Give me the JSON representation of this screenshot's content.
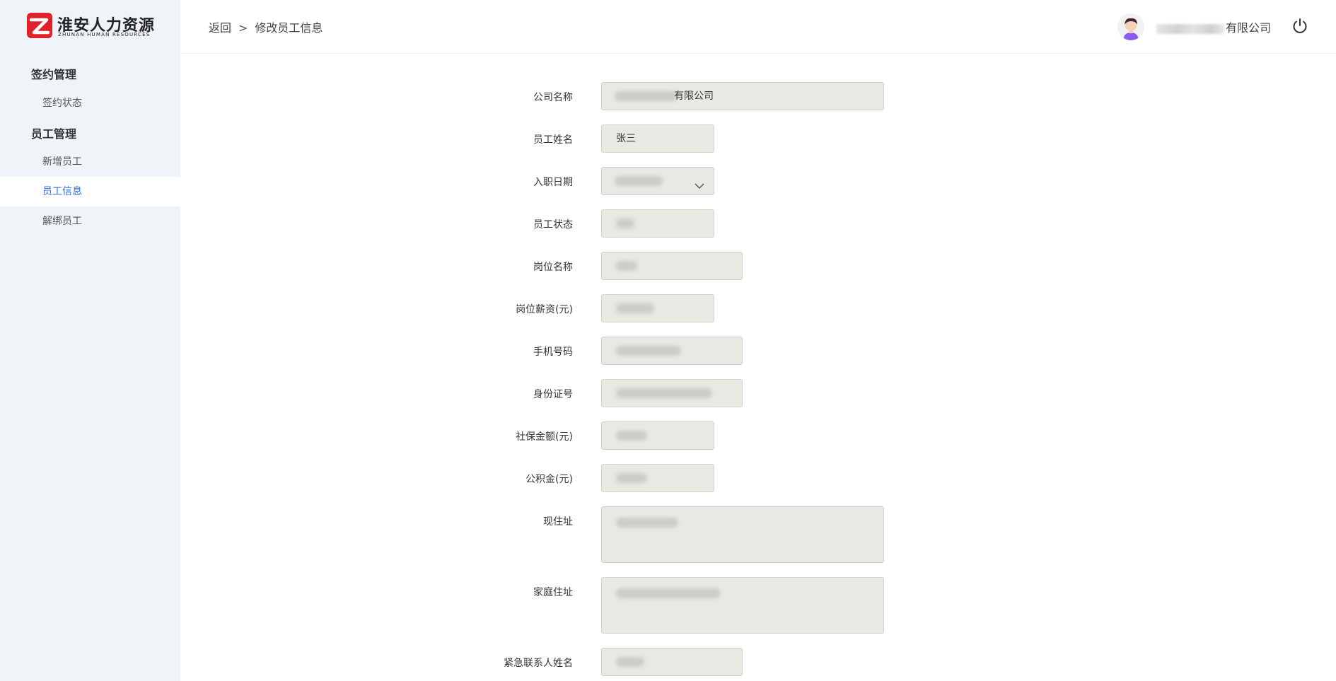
{
  "brand": {
    "name_cn": "淮安人力资源",
    "name_en": "ZHUNAN HUMAN RESOURCES",
    "color": "#e0222a"
  },
  "sidebar": {
    "groups": [
      {
        "title": "签约管理",
        "items": [
          {
            "label": "签约状态"
          }
        ]
      },
      {
        "title": "员工管理",
        "items": [
          {
            "label": "新增员工"
          },
          {
            "label": "员工信息"
          },
          {
            "label": "解绑员工"
          }
        ]
      }
    ],
    "active_item": "员工信息",
    "active_color": "#2f6fe0"
  },
  "header": {
    "back_label": "返回",
    "separator": ">",
    "page_title": "修改员工信息",
    "company_suffix": "有限公司",
    "avatar_icon": "user-avatar-icon",
    "logout_icon": "power-icon"
  },
  "form": {
    "company_name": {
      "label": "公司名称",
      "value_suffix": "有限公司"
    },
    "employee_name": {
      "label": "员工姓名",
      "value": "张三"
    },
    "hire_date": {
      "label": "入职日期"
    },
    "employee_status": {
      "label": "员工状态"
    },
    "position_name": {
      "label": "岗位名称"
    },
    "position_salary": {
      "label": "岗位薪资(元)"
    },
    "phone": {
      "label": "手机号码"
    },
    "id_number": {
      "label": "身份证号"
    },
    "social_security": {
      "label": "社保金额(元)"
    },
    "housing_fund": {
      "label": "公积金(元)"
    },
    "current_address": {
      "label": "现住址"
    },
    "home_address": {
      "label": "家庭住址"
    },
    "emergency_contact": {
      "label": "紧急联系人姓名"
    }
  }
}
